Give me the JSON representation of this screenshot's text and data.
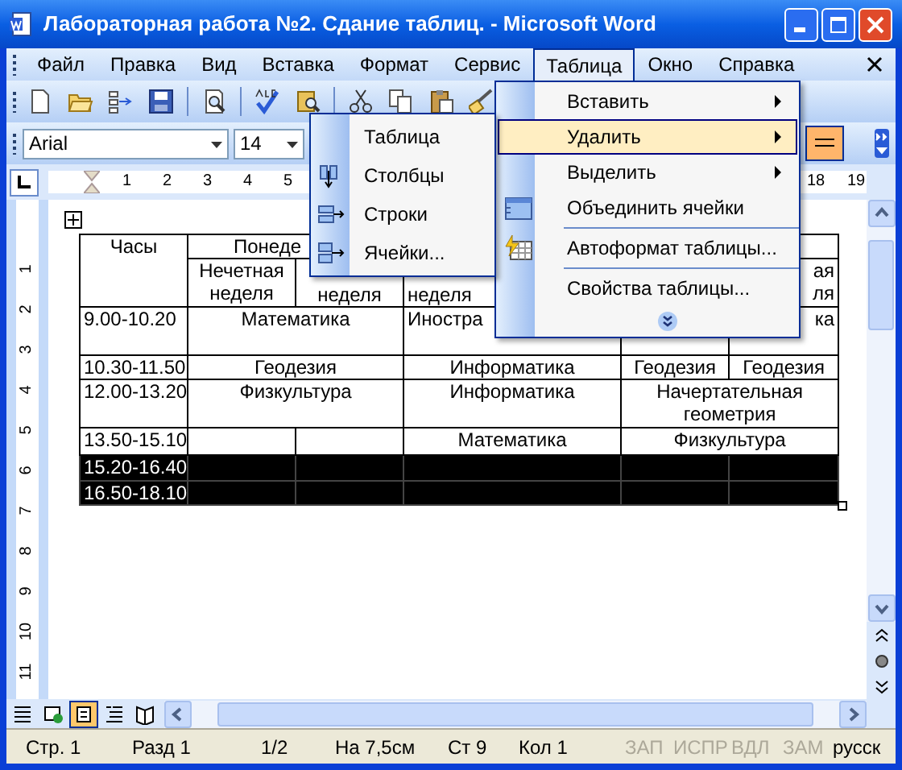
{
  "window": {
    "title": "Лабораторная работа №2. Сдание таблиц. - Microsoft Word"
  },
  "menu_bar": [
    {
      "label": "Файл",
      "selected": false
    },
    {
      "label": "Правка",
      "selected": false
    },
    {
      "label": "Вид",
      "selected": false
    },
    {
      "label": "Вставка",
      "selected": false
    },
    {
      "label": "Формат",
      "selected": false
    },
    {
      "label": "Сервис",
      "selected": false
    },
    {
      "label": "Таблица",
      "selected": true
    },
    {
      "label": "Окно",
      "selected": false
    },
    {
      "label": "Справка",
      "selected": false
    }
  ],
  "formatting_toolbar": {
    "font": "Arial",
    "size": "14",
    "borders_selected": true
  },
  "ruler": {
    "horizontal": [
      "1",
      "2",
      "3",
      "4",
      "5",
      "18",
      "19"
    ],
    "vertical": [
      "1",
      "2",
      "3",
      "4",
      "5",
      "6",
      "7",
      "8",
      "9",
      "10",
      "11"
    ]
  },
  "table": {
    "rows": [
      {
        "selected": false,
        "cells": [
          {
            "text": "Часы"
          },
          {
            "text": "Понеде",
            "colspan": 2
          },
          {},
          {
            "colspan": 2
          }
        ]
      },
      {
        "selected": false,
        "cells": [
          {},
          {
            "text": "Нечетная неделя"
          },
          {
            "text": "неделя"
          },
          {
            "text": "неделя"
          },
          {},
          {
            "lines": [
              "ая",
              "ля"
            ]
          }
        ]
      },
      {
        "selected": false,
        "cells": [
          {
            "text": "9.00-10.20"
          },
          {
            "text": "Математика",
            "colspan": 2
          },
          {
            "text": "Иностра"
          },
          {},
          {
            "text": "ка"
          }
        ]
      },
      {
        "selected": false,
        "cells": [
          {
            "text": "10.30-11.50"
          },
          {
            "text": "Геодезия",
            "colspan": 2
          },
          {
            "text": "Информатика"
          },
          {
            "text": "Геодезия"
          },
          {
            "text": "Геодезия"
          }
        ]
      },
      {
        "selected": false,
        "cells": [
          {
            "text": "12.00-13.20"
          },
          {
            "text": "Физкультура",
            "colspan": 2
          },
          {
            "text": "Информатика"
          },
          {
            "text": "Начертательная геометрия",
            "colspan": 2
          }
        ]
      },
      {
        "selected": false,
        "cells": [
          {
            "text": "13.50-15.10"
          },
          {},
          {},
          {
            "text": "Математика"
          },
          {
            "text": "Физкультура",
            "colspan": 2
          }
        ]
      },
      {
        "selected": true,
        "cells": [
          {
            "text": "15.20-16.40"
          },
          {},
          {},
          {},
          {},
          {}
        ]
      },
      {
        "selected": true,
        "cells": [
          {
            "text": "16.50-18.10"
          },
          {},
          {},
          {},
          {},
          {}
        ]
      }
    ]
  },
  "table_menu": {
    "items": [
      {
        "kind": "item",
        "label": "Вставить",
        "submenu": true,
        "selected": false
      },
      {
        "kind": "item",
        "label": "Удалить",
        "submenu": true,
        "selected": true
      },
      {
        "kind": "item",
        "label": "Выделить",
        "submenu": true,
        "selected": false
      },
      {
        "kind": "item",
        "label": "Объединить ячейки",
        "submenu": false,
        "selected": false
      },
      {
        "kind": "separator"
      },
      {
        "kind": "item",
        "label": "Автоформат таблицы...",
        "submenu": false,
        "selected": false
      },
      {
        "kind": "separator"
      },
      {
        "kind": "item",
        "label": "Свойства таблицы...",
        "submenu": false,
        "selected": false
      },
      {
        "kind": "expand"
      }
    ]
  },
  "delete_submenu": {
    "items": [
      {
        "label": "Таблица"
      },
      {
        "label": "Столбцы"
      },
      {
        "label": "Строки"
      },
      {
        "label": "Ячейки..."
      }
    ]
  },
  "view_buttons": [
    {
      "selected": false
    },
    {
      "selected": false
    },
    {
      "selected": true
    },
    {
      "selected": false
    },
    {
      "selected": false
    }
  ],
  "status_bar": [
    {
      "text": "Стр. 1",
      "disabled": false
    },
    {
      "text": "Разд 1",
      "disabled": false
    },
    {
      "text": "1/2",
      "disabled": false
    },
    {
      "text": "На 7,5см",
      "disabled": false
    },
    {
      "text": "Ст 9",
      "disabled": false
    },
    {
      "text": "Кол 1",
      "disabled": false
    },
    {
      "text": "ЗАП",
      "disabled": true
    },
    {
      "text": "ИСПР",
      "disabled": true
    },
    {
      "text": "ВДЛ",
      "disabled": true
    },
    {
      "text": "ЗАМ",
      "disabled": true
    },
    {
      "text": "русск",
      "disabled": false
    }
  ]
}
